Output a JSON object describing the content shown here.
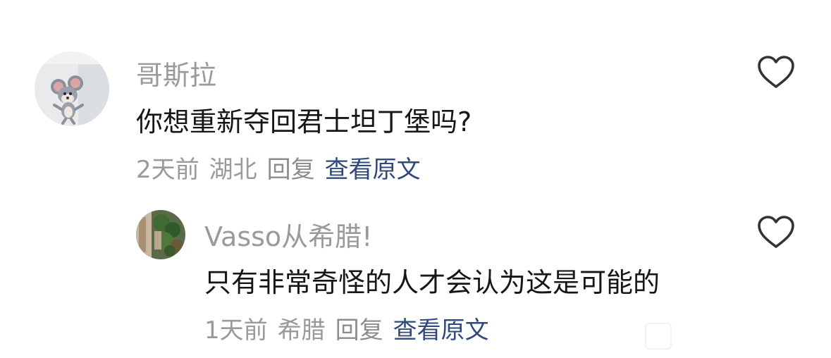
{
  "comments": [
    {
      "avatar": "mouse-cartoon-avatar",
      "username": "哥斯拉",
      "text": "你想重新夺回君士坦丁堡吗?",
      "time": "2天前",
      "location": "湖北",
      "reply_label": "回复",
      "view_original_label": "查看原文",
      "like_icon": "heart-outline-icon"
    },
    {
      "avatar": "greenery-photo-avatar",
      "username": "Vasso从希腊!",
      "text": "只有非常奇怪的人才会认为这是可能的",
      "time": "1天前",
      "location": "希腊",
      "reply_label": "回复",
      "view_original_label": "查看原文",
      "like_icon": "heart-outline-icon"
    }
  ],
  "colors": {
    "username": "#9a9a9a",
    "text": "#161616",
    "meta": "#9a9a9a",
    "link": "#2f4a7a",
    "icon": "#333333"
  }
}
